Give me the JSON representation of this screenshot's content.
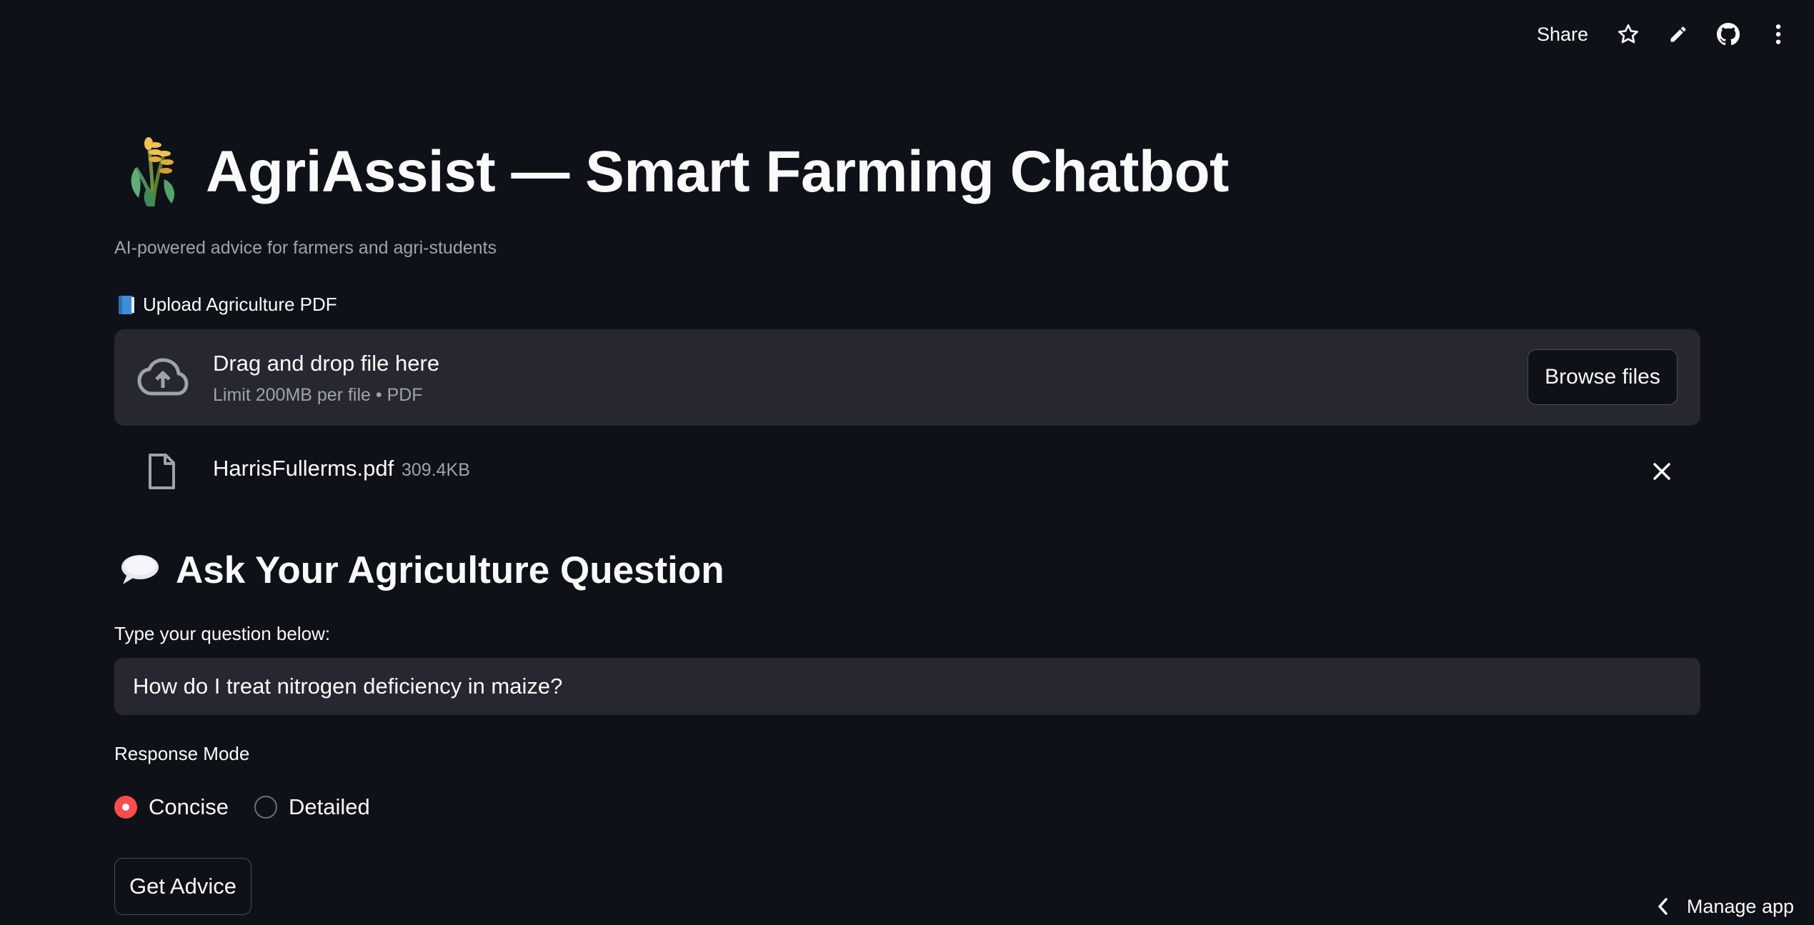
{
  "toolbar": {
    "share_label": "Share",
    "icons": [
      "star-icon",
      "pencil-icon",
      "github-icon",
      "more-vertical-icon"
    ]
  },
  "header": {
    "title": "AgriAssist — Smart Farming Chatbot",
    "title_icon": "sheaf-of-rice-emoji",
    "subtitle": "AI-powered advice for farmers and agri-students"
  },
  "upload": {
    "label": "Upload Agriculture PDF",
    "label_icon": "blue-book-emoji",
    "dropzone": {
      "main_text": "Drag and drop file here",
      "sub_text": "Limit 200MB per file • PDF",
      "icon": "cloud-upload-icon"
    },
    "browse_label": "Browse files",
    "file": {
      "name": "HarrisFullerms.pdf",
      "size": "309.4KB",
      "icon": "file-icon"
    }
  },
  "question_section": {
    "title": "Ask Your Agriculture Question",
    "title_icon": "speech-balloon-emoji",
    "input_label": "Type your question below:",
    "input_value": "How do I treat nitrogen deficiency in maize?"
  },
  "response_mode": {
    "label": "Response Mode",
    "options": [
      {
        "label": "Concise",
        "selected": true
      },
      {
        "label": "Detailed",
        "selected": false
      }
    ]
  },
  "submit": {
    "label": "Get Advice"
  },
  "footer": {
    "manage_app_label": "Manage app"
  },
  "colors": {
    "background": "#0e1117",
    "surface": "#262730",
    "accent": "#ff4b4b",
    "text": "#fafafa",
    "muted_text": "#9ea3ab"
  }
}
